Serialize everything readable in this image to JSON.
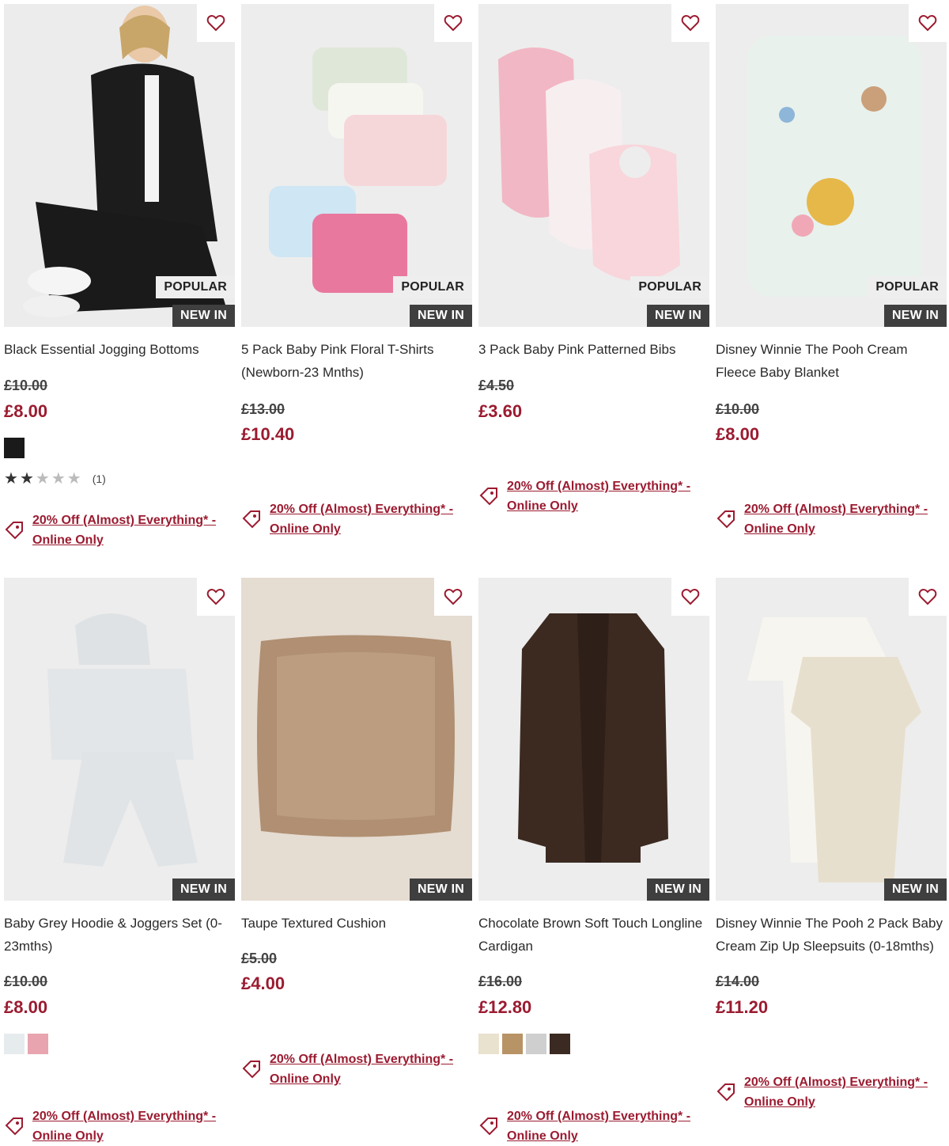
{
  "promo_text": "20% Off (Almost) Everything* - Online Only",
  "badges": {
    "popular": "POPULAR",
    "new_in": "NEW IN"
  },
  "colors": {
    "accent": "#9b1b30",
    "badge_dark": "#3f3f3f"
  },
  "products": [
    {
      "title": "Black Essential Jogging Bottoms",
      "was_price": "£10.00",
      "now_price": "£8.00",
      "popular": true,
      "new_in": true,
      "swatches": [
        "#1a1a1a"
      ],
      "rating": 2,
      "rating_count": "(1)"
    },
    {
      "title": "5 Pack Baby Pink Floral T-Shirts (Newborn-23 Mnths)",
      "was_price": "£13.00",
      "now_price": "£10.40",
      "popular": true,
      "new_in": true,
      "swatches": []
    },
    {
      "title": "3 Pack Baby Pink Patterned Bibs",
      "was_price": "£4.50",
      "now_price": "£3.60",
      "popular": true,
      "new_in": true,
      "swatches": []
    },
    {
      "title": "Disney Winnie The Pooh Cream Fleece Baby Blanket",
      "was_price": "£10.00",
      "now_price": "£8.00",
      "popular": true,
      "new_in": true,
      "swatches": []
    },
    {
      "title": "Baby Grey Hoodie & Joggers Set (0-23mths)",
      "was_price": "£10.00",
      "now_price": "£8.00",
      "popular": false,
      "new_in": true,
      "swatches": [
        "#e6ebee",
        "#e8a5b0"
      ]
    },
    {
      "title": "Taupe Textured Cushion",
      "was_price": "£5.00",
      "now_price": "£4.00",
      "popular": false,
      "new_in": true,
      "swatches": []
    },
    {
      "title": "Chocolate Brown Soft Touch Longline Cardigan",
      "was_price": "£16.00",
      "now_price": "£12.80",
      "popular": false,
      "new_in": true,
      "swatches": [
        "#e9e2cf",
        "#b89366",
        "#cfcfcf",
        "#3b2a22"
      ]
    },
    {
      "title": "Disney Winnie The Pooh 2 Pack Baby Cream Zip Up Sleepsuits (0-18mths)",
      "was_price": "£14.00",
      "now_price": "£11.20",
      "popular": false,
      "new_in": true,
      "swatches": []
    }
  ]
}
